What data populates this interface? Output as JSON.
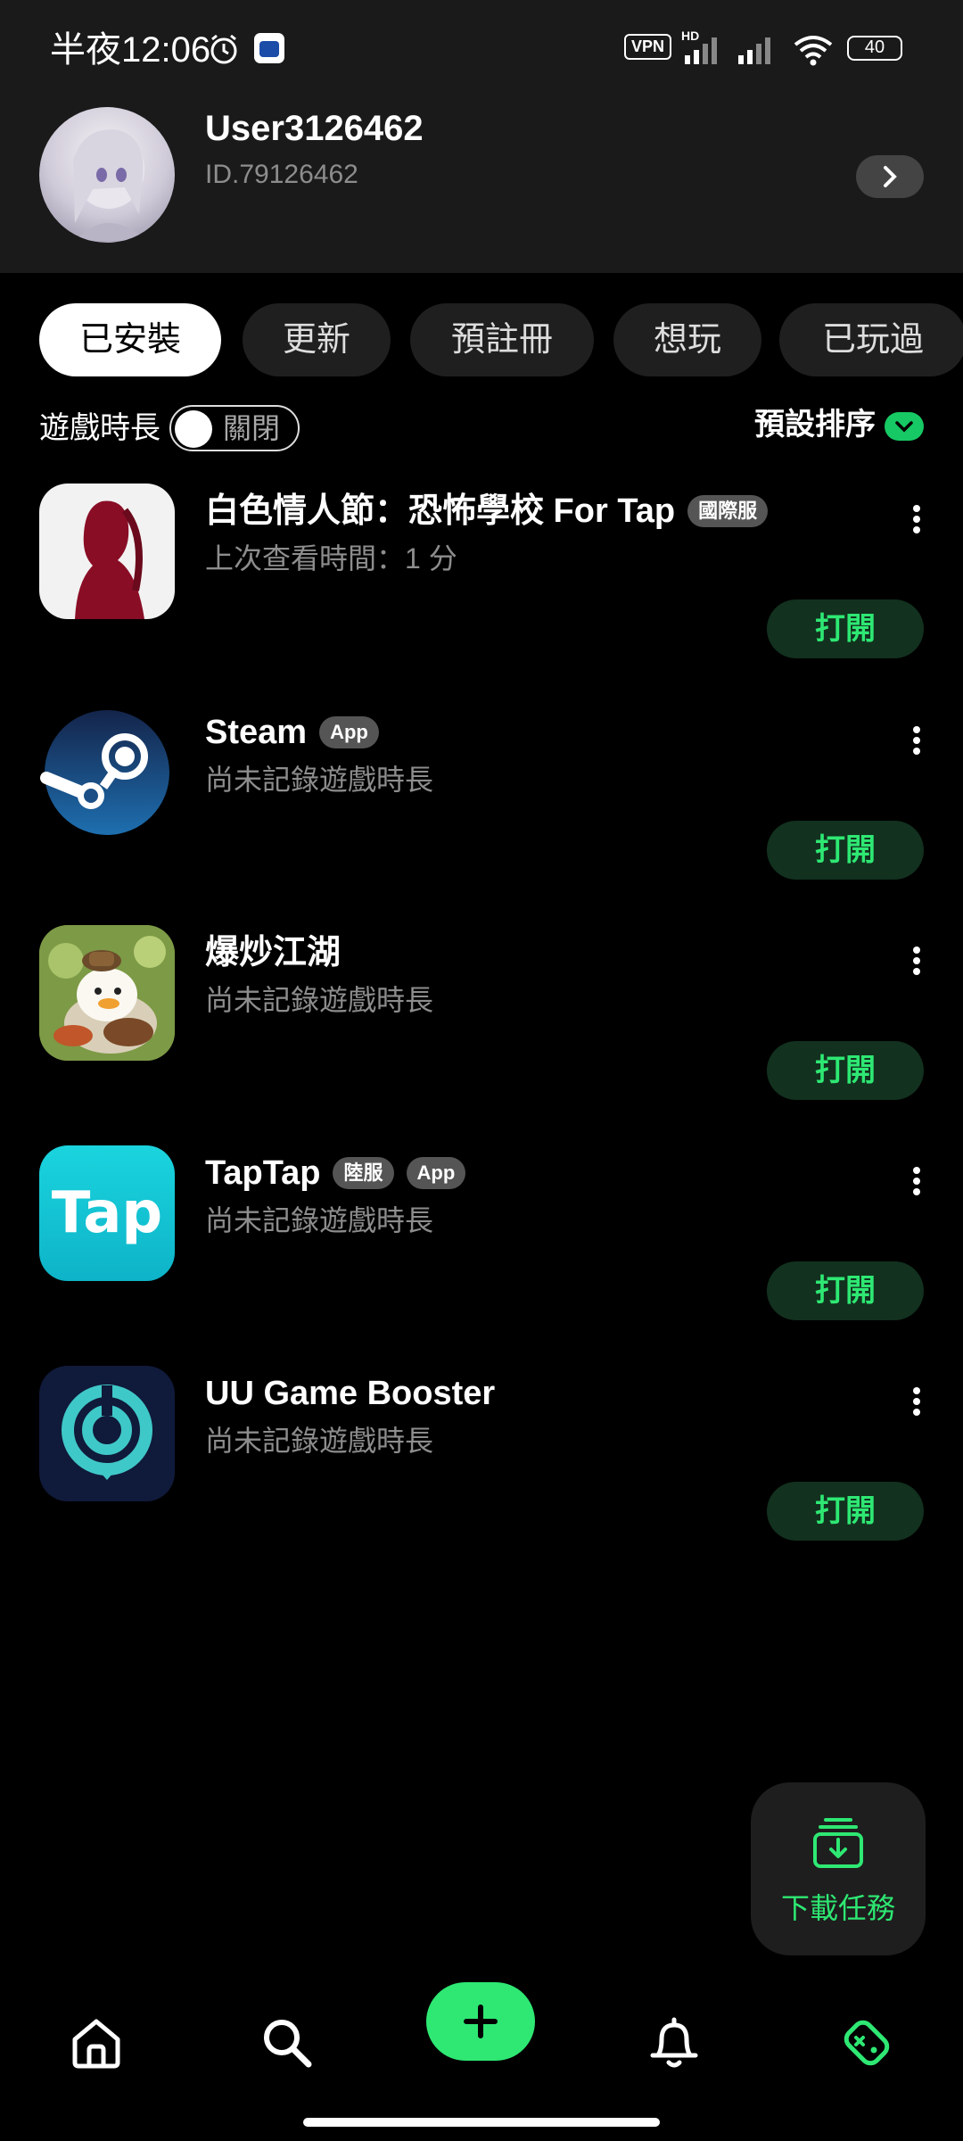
{
  "status_bar": {
    "time": "半夜12:06",
    "vpn_label": "VPN",
    "battery": "40",
    "network_hd": "HD"
  },
  "profile": {
    "username": "User3126462",
    "user_id": "ID.79126462"
  },
  "tabs": [
    {
      "label": "已安裝",
      "active": true
    },
    {
      "label": "更新",
      "active": false
    },
    {
      "label": "預註冊",
      "active": false
    },
    {
      "label": "想玩",
      "active": false
    },
    {
      "label": "已玩過",
      "active": false
    }
  ],
  "filter": {
    "playtime_label": "遊戲時長",
    "toggle_label": "關閉",
    "sort_label": "預設排序"
  },
  "games": [
    {
      "name": "白色情人節：恐怖學校 For Tap",
      "badges": [
        "國際服"
      ],
      "subtitle": "上次查看時間：1 分",
      "button": "打開"
    },
    {
      "name": "Steam",
      "badges": [
        "App"
      ],
      "subtitle": "尚未記錄遊戲時長",
      "button": "打開"
    },
    {
      "name": "爆炒江湖",
      "badges": [],
      "subtitle": "尚未記錄遊戲時長",
      "button": "打開"
    },
    {
      "name": "TapTap",
      "badges": [
        "陸服",
        "App"
      ],
      "subtitle": "尚未記錄遊戲時長",
      "button": "打開"
    },
    {
      "name": "UU Game Booster",
      "badges": [],
      "subtitle": "尚未記錄遊戲時長",
      "button": "打開"
    }
  ],
  "download_task": {
    "label": "下載任務"
  },
  "app_icons": {
    "taptap_text": "Tap"
  },
  "colors": {
    "accent": "#2ee873",
    "open_button_bg": "#12311f",
    "header_bg": "#1a1a1a"
  },
  "nav": [
    "home-icon",
    "search-icon",
    "add-icon",
    "bell-icon",
    "game-tag-icon"
  ]
}
